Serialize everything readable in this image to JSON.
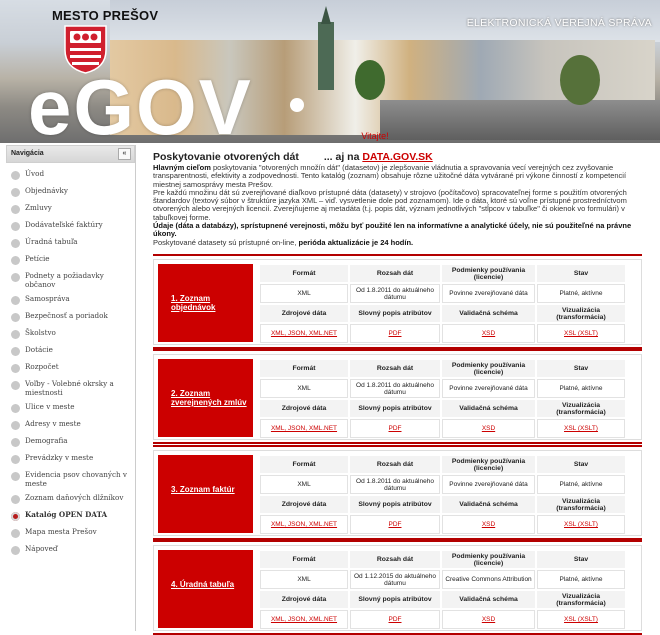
{
  "header": {
    "town_name": "MESTO PREŠOV",
    "logo_text": "eGOV",
    "tagline": "ELEKTRONICKÁ VEREJNÁ SPRÁVA",
    "welcome": "Vitajte!",
    "crest_colors": {
      "red": "#d01f2e",
      "white": "#ffffff"
    }
  },
  "sidebar": {
    "title": "Navigácia",
    "collapse_label": "«",
    "items": [
      {
        "label": "Úvod"
      },
      {
        "label": "Objednávky"
      },
      {
        "label": "Zmluvy"
      },
      {
        "label": "Dodávateľské faktúry"
      },
      {
        "label": "Úradná tabuľa"
      },
      {
        "label": "Petície"
      },
      {
        "label": "Podnety a požiadavky občanov"
      },
      {
        "label": "Samospráva"
      },
      {
        "label": "Bezpečnosť a poriadok"
      },
      {
        "label": "Školstvo"
      },
      {
        "label": "Dotácie"
      },
      {
        "label": "Rozpočet"
      },
      {
        "label": "Voľby - Volebné okrsky a miestnosti"
      },
      {
        "label": "Ulice v meste"
      },
      {
        "label": "Adresy v meste"
      },
      {
        "label": "Demografia"
      },
      {
        "label": "Prevádzky v meste"
      },
      {
        "label": "Evidencia psov chovaných v meste"
      },
      {
        "label": "Zoznam daňových dlžníkov"
      },
      {
        "label": "Katalóg OPEN DATA",
        "active": true
      },
      {
        "label": "Mapa mesta Prešov"
      },
      {
        "label": "Nápoveď"
      }
    ]
  },
  "main": {
    "title": "Poskytovanie otvorených dát",
    "title_also": "... aj na",
    "title_link": "DATA.GOV.SK",
    "intro_lead": "Hlavným cieľom",
    "intro_p1": " poskytovania \"otvorených množín dát\" (datasetov) je zlepšovanie vládnutia a spravovania vecí verejných cez zvyšovanie transparentnosti, efektivity a zodpovednosti. Tento katalóg (zoznam) obsahuje rôzne užitočné dáta vytvárané pri výkone činností z kompetencií miestnej samosprávy mesta Prešov.",
    "intro_p2": "Pre každú množinu dát sú zverejňované diaľkovo prístupné dáta (datasety) v strojovo (počítačovo) spracovateľnej forme s použitím otvorených štandardov (textový súbor v štruktúre jazyka XML – viď. vysvetlenie dole pod zoznamom). Ide o dáta, ktoré sú voľne prístupné prostredníctvom otvorených alebo verejných licencií. Zverejňujeme aj metadáta (t.j. popis dát, význam jednotlivých \"stĺpcov v tabuľke\" či okienok vo formulári) v tabuľkovej forme.",
    "intro_bold": "Údaje (dáta a databázy), sprístupnené verejnosti, môžu byť použité len na informatívne a analytické účely, nie sú použiteľné na právne úkony.",
    "intro_p3": "Poskytované datasety sú prístupné on-line, ",
    "intro_p3_bold": "perióda aktualizácie je 24 hodín."
  },
  "table_headers": {
    "format": "Formát",
    "range": "Rozsah dát",
    "conditions": "Podmienky používania (licencie)",
    "status": "Stav",
    "sources": "Zdrojové dáta",
    "verbal": "Slovný popis atribútov",
    "schema": "Validačná schéma",
    "visualization": "Vizualizácia (transformácia)"
  },
  "datasets": [
    {
      "name": "1. Zoznam objednávok",
      "format": "XML",
      "range": "Od 1.8.2011 do aktuálneho dátumu",
      "license": "Povinne zverejňované dáta",
      "status": "Platné, aktívne",
      "sources": "XML, JSON, XML.NET",
      "verbal": "PDF",
      "schema": "XSD",
      "visualization": "XSL (XSLT)"
    },
    {
      "name": "2. Zoznam zverejnených zmlúv",
      "format": "XML",
      "range": "Od 1.8.2011 do aktuálneho dátumu",
      "license": "Povinne zverejňované dáta",
      "status": "Platné, aktívne",
      "sources": "XML, JSON, XML.NET",
      "verbal": "PDF",
      "schema": "XSD",
      "visualization": "XSL (XSLT)"
    },
    {
      "name": "3. Zoznam faktúr",
      "format": "XML",
      "range": "Od 1.8.2011 do aktuálneho dátumu",
      "license": "Povinne zverejňované dáta",
      "status": "Platné, aktívne",
      "sources": "XML, JSON, XML.NET",
      "verbal": "PDF",
      "schema": "XSD",
      "visualization": "XSL (XSLT)"
    },
    {
      "name": "4. Úradná tabuľa",
      "format": "XML",
      "range": "Od 1.12.2015 do aktuálneho dátumu",
      "license": "Creative Commons Attribution",
      "status": "Platné, aktívne",
      "sources": "XML, JSON, XML.NET",
      "verbal": "PDF",
      "schema": "XSD",
      "visualization": "XSL (XSLT)"
    }
  ]
}
